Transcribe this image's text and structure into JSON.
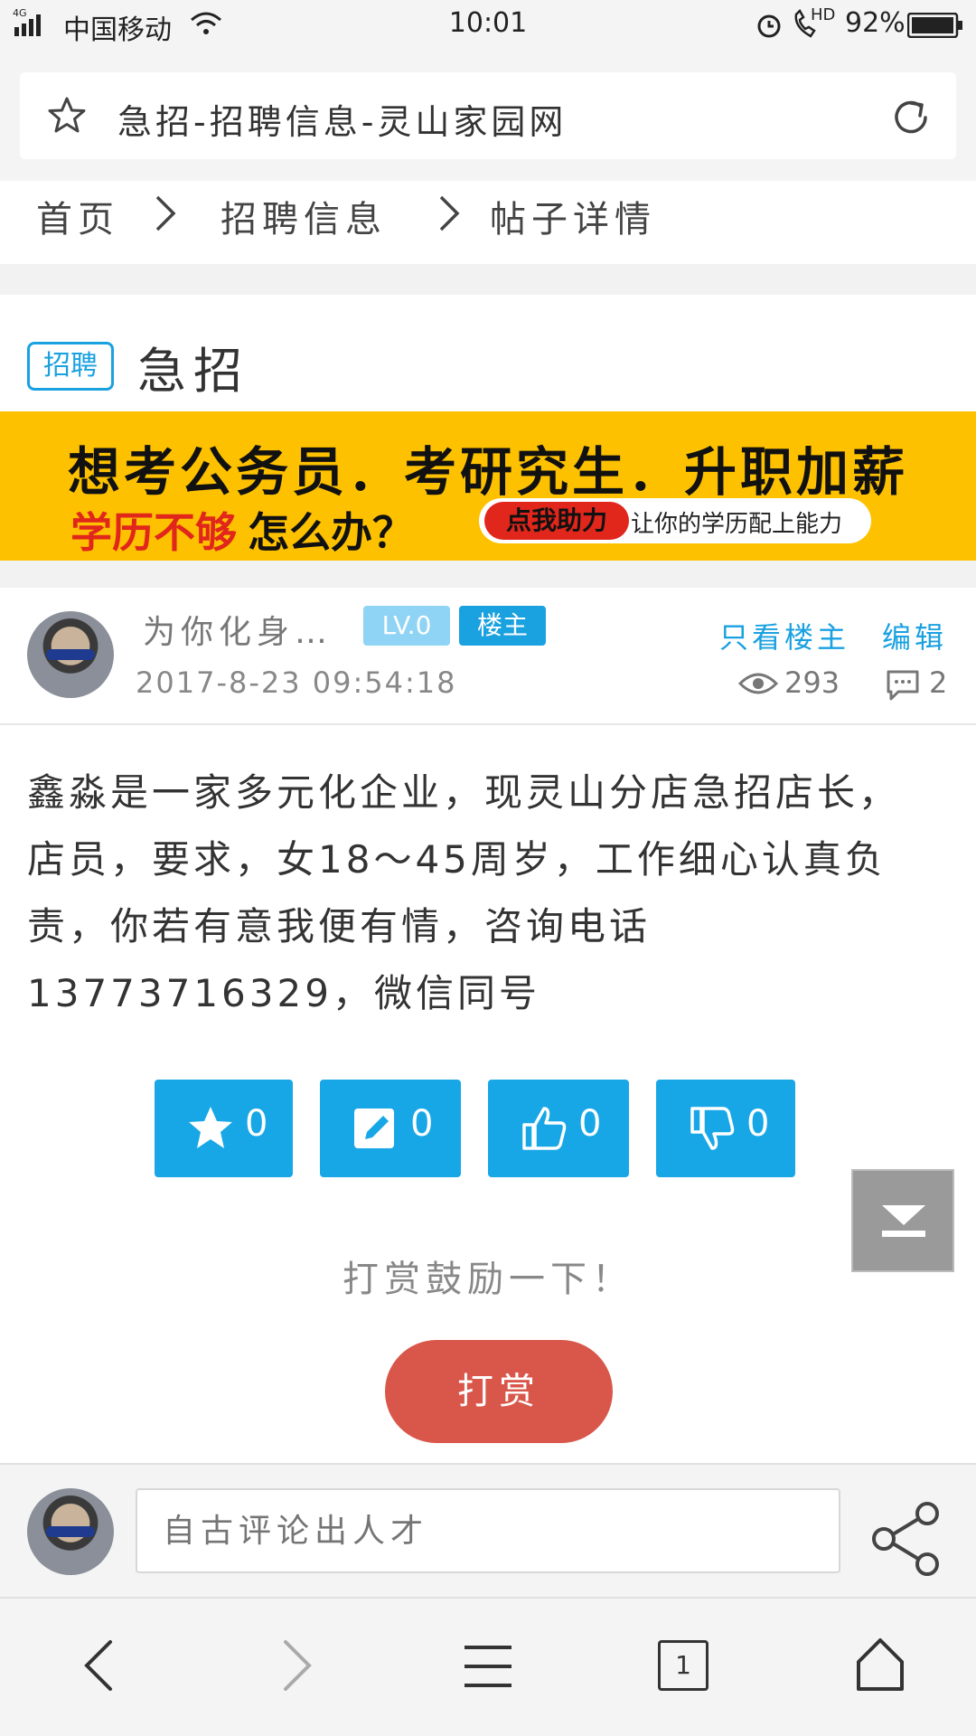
{
  "status_bar": {
    "network": "4G",
    "carrier": "中国移动",
    "time": "10:01",
    "hd": "HD",
    "battery": "92%"
  },
  "address_bar": {
    "page_title": "急招-招聘信息-灵山家园网",
    "star_icon": "star-outline-icon",
    "refresh_icon": "refresh-icon"
  },
  "breadcrumb": {
    "items": [
      "首页",
      "招聘信息",
      "帖子详情"
    ]
  },
  "post": {
    "tag": "招聘",
    "title": "急招"
  },
  "banner": {
    "line1": "想考公务员．考研究生．升职加薪",
    "line2_red": "学历不够",
    "line2_black": "怎么办？",
    "cta_button": "点我助力",
    "cta_text": "让你的学历配上能力"
  },
  "author": {
    "name": "为你化身…",
    "level": "LV.0",
    "badge": "楼主",
    "time": "2017-8-23 09:54:18",
    "only_owner": "只看楼主",
    "edit": "编辑",
    "views": "293",
    "comments": "2"
  },
  "content": {
    "body": "鑫淼是一家多元化企业，现灵山分店急招店长，店员，要求，女18～45周岁，工作细心认真负责，你若有意我便有情，咨询电话13773716329，微信同号"
  },
  "actions": {
    "favorite_count": "0",
    "edit_count": "0",
    "like_count": "0",
    "dislike_count": "0"
  },
  "reward": {
    "prompt": "打赏鼓励一下！",
    "button": "打赏"
  },
  "comment_bar": {
    "placeholder": "自古评论出人才"
  },
  "bottom_nav": {
    "tabs_count": "1"
  },
  "colors": {
    "accent": "#1aa1e0",
    "action_button": "#18a7e6",
    "reward_button": "#d9574a",
    "banner_bg": "#fdc100"
  }
}
